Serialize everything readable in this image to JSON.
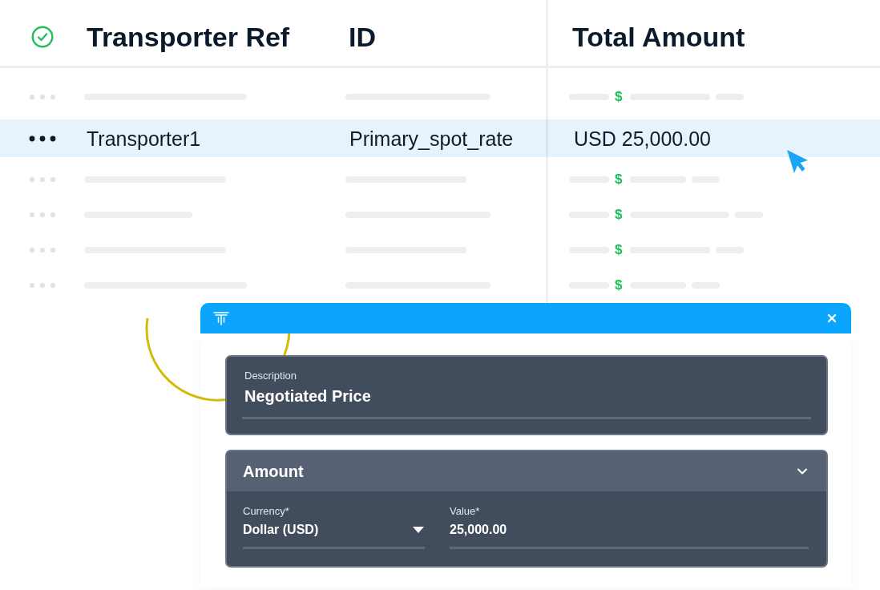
{
  "table": {
    "columns": [
      {
        "label": "Transporter Ref"
      },
      {
        "label": "ID"
      },
      {
        "label": "Total Amount"
      }
    ],
    "rows": [
      {
        "kind": "skeleton",
        "selected": false,
        "currency_symbol": "$"
      },
      {
        "kind": "data",
        "selected": true,
        "transporter_ref": "Transporter1",
        "id": "Primary_spot_rate",
        "total_amount": "USD 25,000.00"
      },
      {
        "kind": "skeleton",
        "selected": false,
        "currency_symbol": "$"
      },
      {
        "kind": "skeleton",
        "selected": false,
        "currency_symbol": "$"
      },
      {
        "kind": "skeleton",
        "selected": false,
        "currency_symbol": "$"
      },
      {
        "kind": "skeleton",
        "selected": false,
        "currency_symbol": "$"
      }
    ]
  },
  "dialog": {
    "description": {
      "label": "Description",
      "value": "Negotiated Price"
    },
    "amount": {
      "title": "Amount",
      "expanded": true,
      "currency": {
        "label": "Currency*",
        "value": "Dollar (USD)"
      },
      "value": {
        "label": "Value*",
        "value": "25,000.00"
      }
    }
  }
}
